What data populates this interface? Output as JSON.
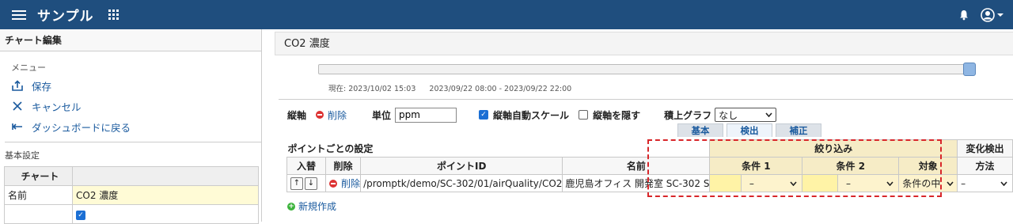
{
  "app": {
    "title": "サンプル"
  },
  "sidebar": {
    "title": "チャート編集",
    "menu_heading": "メニュー",
    "items": [
      {
        "label": "保存",
        "icon": "upload-icon"
      },
      {
        "label": "キャンセル",
        "icon": "close-icon"
      },
      {
        "label": "ダッシュボードに戻る",
        "icon": "back-arrow-icon"
      }
    ],
    "basic_heading": "基本設定",
    "table": {
      "header": "チャート",
      "name_label": "名前",
      "name_value": "CO2 濃度"
    }
  },
  "main": {
    "title": "CO2 濃度",
    "current_time": "現在: 2023/10/02 15:03",
    "range": "2023/09/22 08:00 - 2023/09/22 22:00",
    "axis": {
      "label": "縦軸",
      "delete": "削除",
      "unit_label": "単位",
      "unit_value": "ppm",
      "auto_scale": "縦軸自動スケール",
      "auto_scale_checked": true,
      "hide_axis": "縦軸を隠す",
      "hide_axis_checked": false,
      "stack_label": "積上グラフ",
      "stack_value": "なし"
    },
    "tabs": [
      "基本",
      "検出",
      "補正"
    ],
    "active_tab": "検出",
    "points_heading": "ポイントごとの設定",
    "table": {
      "group_filter": "絞り込み",
      "group_change": "変化検出",
      "headers": [
        "入替",
        "削除",
        "ポイントID",
        "名前",
        "条件 1",
        "条件 2",
        "対象",
        "方法"
      ],
      "row": {
        "delete": "削除",
        "point_id": "/promptk/demo/SC-302/01/airQuality/CO2",
        "name": "鹿児島オフィス 開発室 SC-302 S",
        "cond1_op": "–",
        "cond2_op": "–",
        "target": "条件の中",
        "method": "–"
      }
    },
    "new_label": "新規作成"
  },
  "colors": {
    "topbar": "#1f4e7e",
    "link": "#1a5a9e",
    "highlight_box": "#d8262a",
    "filter_bg": "#f6ecc6"
  }
}
